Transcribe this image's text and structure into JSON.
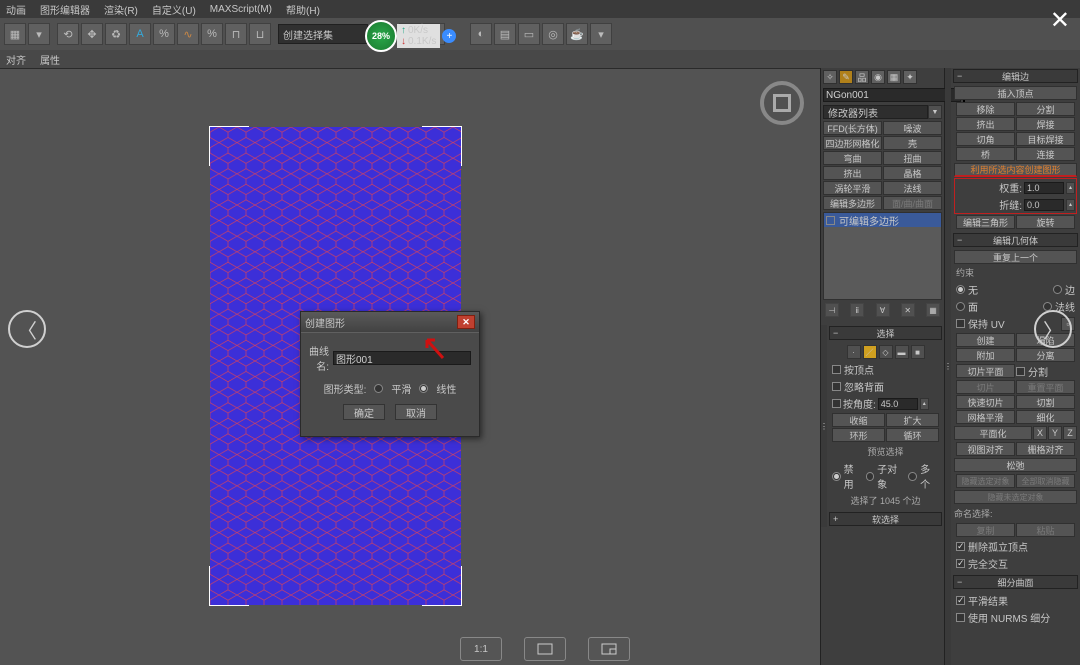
{
  "menu": {
    "items": [
      "动画",
      "图形编辑器",
      "渲染(R)",
      "自定义(U)",
      "MAXScript(M)",
      "帮助(H)"
    ]
  },
  "toolbar": {
    "dropdown1": "创建选择集",
    "speed": {
      "pct": "28%",
      "up": "0K/s",
      "down": "0.1K/s"
    }
  },
  "subbar": {
    "items": [
      "对齐",
      "属性"
    ]
  },
  "viewport_ctrl": {
    "btn1": "1:1",
    "btn2": "▢",
    "btn3": "▢"
  },
  "dialog": {
    "title": "创建图形",
    "label_name": "曲线名:",
    "name_value": "图形001",
    "label_type": "图形类型:",
    "radio_smooth": "平滑",
    "radio_linear": "线性",
    "ok": "确定",
    "cancel": "取消"
  },
  "panelA": {
    "object_name": "NGon001",
    "mod_dropdown": "修改器列表",
    "grid_buttons": [
      "FFD(长方体)",
      "噪波",
      "四边形网格化",
      "壳",
      "弯曲",
      "扭曲",
      "挤出",
      "晶格",
      "涡轮平滑",
      "法线",
      "编辑多边形",
      "面/曲/曲面"
    ],
    "stack_item": "可编辑多边形",
    "rollout_select": "选择",
    "chk_byvertex": "按顶点",
    "chk_ignore_back": "忽略背面",
    "lbl_byangle": "按角度:",
    "val_byangle": "45.0",
    "btn_shrink": "收缩",
    "btn_grow": "扩大",
    "btn_ring": "环形",
    "btn_loop": "循环",
    "preview_label": "预览选择",
    "radio_disable": "禁用",
    "radio_subobj": "子对象",
    "radio_multi": "多个",
    "status": "选择了 1045 个边",
    "rollout_soft": "软选择"
  },
  "panelB": {
    "rollout_edit_edge": "编辑边",
    "btn_insert_vert": "插入顶点",
    "grid1": [
      "移除",
      "分割",
      "挤出",
      "焊接",
      "切角",
      "目标焊接",
      "桥",
      "连接"
    ],
    "btn_create_shape": "利用所选内容创建图形",
    "lbl_weight": "权重:",
    "val_weight": "1.0",
    "lbl_crease": "折缝:",
    "val_crease": "0.0",
    "btn_edit_tri": "编辑三角形",
    "btn_turn": "旋转",
    "rollout_edit_geom": "编辑几何体",
    "btn_repeat": "重复上一个",
    "lbl_constrain": "约束",
    "radio_none": "无",
    "radio_edge": "边",
    "radio_face": "面",
    "radio_normal": "法线",
    "chk_preserve_uv": "保持 UV",
    "btn_create": "创建",
    "btn_collapse": "塌陷",
    "btn_attach": "附加",
    "btn_detach": "分离",
    "btn_slice_plane": "切片平面",
    "chk_split": "分割",
    "btn_slice": "切片",
    "btn_reset_plane": "重置平面",
    "btn_quickslice": "快速切片",
    "btn_cut": "切割",
    "btn_msmooth": "网格平滑",
    "btn_tess": "细化",
    "btn_planar": "平面化",
    "x": "X",
    "y": "Y",
    "z": "Z",
    "btn_view_align": "视图对齐",
    "btn_grid_align": "栅格对齐",
    "btn_relax": "松弛",
    "btn_hide_sel": "隐藏选定对象",
    "btn_unhide_all": "全部取消隐藏",
    "btn_hide_unsel": "隐藏未选定对象",
    "lbl_named_sel": "命名选择:",
    "btn_copy": "复制",
    "btn_paste": "粘贴",
    "chk_del_iso": "删除孤立顶点",
    "chk_full_inter": "完全交互",
    "rollout_subdiv": "细分曲面",
    "chk_smooth_result": "平滑结果",
    "chk_nurms": "使用 NURMS 细分"
  }
}
